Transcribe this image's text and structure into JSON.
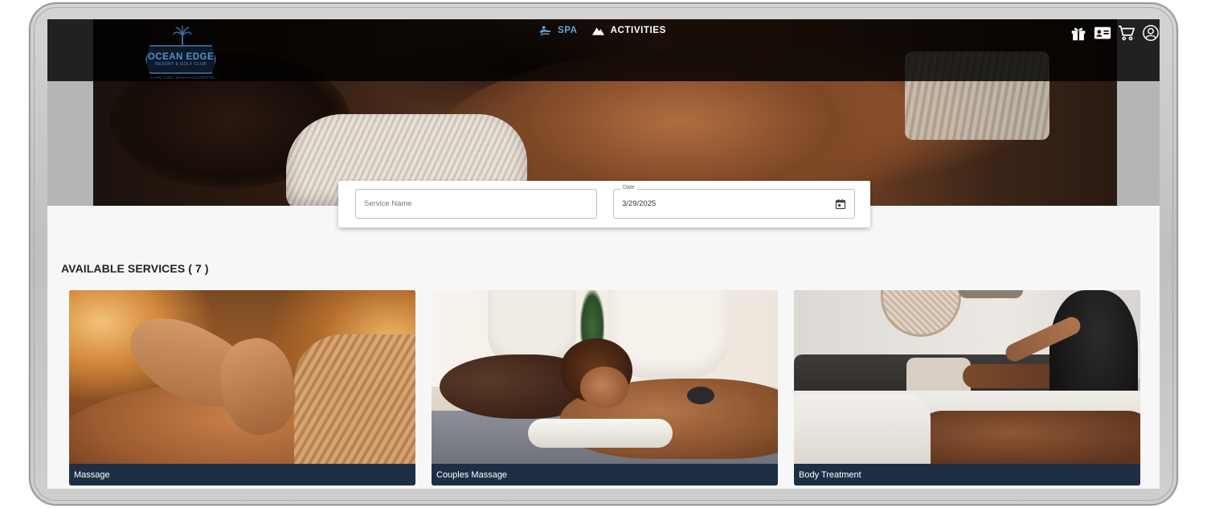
{
  "header": {
    "logo": {
      "name": "OCEAN EDGE",
      "subtitle": "RESORT & GOLF CLUB",
      "tagline": "CAPE COD, MASSACHUSETTS"
    },
    "nav": [
      {
        "label": "SPA",
        "icon": "spa-icon",
        "active": true
      },
      {
        "label": "ACTIVITIES",
        "icon": "mountain-icon",
        "active": false
      }
    ],
    "actions": [
      "gift-icon",
      "id-card-icon",
      "cart-icon",
      "user-account-icon"
    ]
  },
  "search": {
    "service_placeholder": "Service Name",
    "service_value": "",
    "date_label": "Date",
    "date_value": "3/29/2025"
  },
  "services": {
    "title": "AVAILABLE SERVICES ( 7 )",
    "items": [
      {
        "label": "Massage"
      },
      {
        "label": "Couples Massage"
      },
      {
        "label": "Body Treatment"
      }
    ]
  },
  "colors": {
    "nav_active": "#5aa5e0",
    "caption_bg": "#1e2f45",
    "logo_blue": "#5b8fc8"
  }
}
